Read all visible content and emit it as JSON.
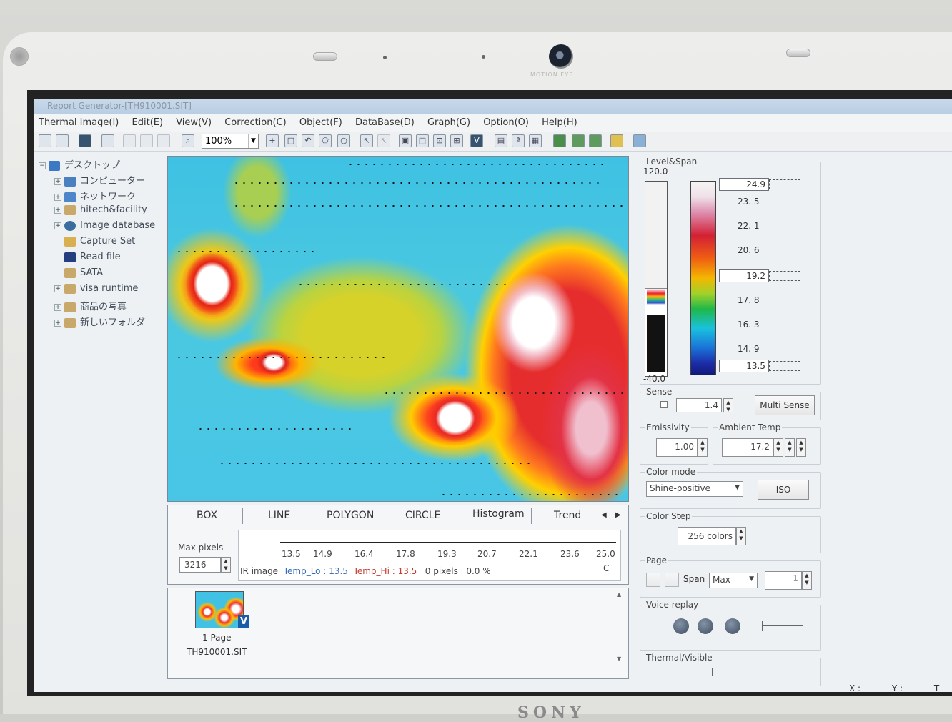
{
  "window": {
    "title": "Report Generator-[TH910001.SIT]"
  },
  "menu": [
    "Thermal Image(I)",
    "Edit(E)",
    "View(V)",
    "Correction(C)",
    "Object(F)",
    "DataBase(D)",
    "Graph(G)",
    "Option(O)",
    "Help(H)"
  ],
  "toolbar": {
    "zoom": "100%"
  },
  "tree": {
    "root": "デスクトップ",
    "items": [
      "コンピューター",
      "ネットワーク",
      "hitech&facility",
      "Image database",
      "Capture Set",
      "Read file",
      "SATA",
      "visa runtime",
      "商品の写真",
      "新しいフォルダ"
    ]
  },
  "analysis": {
    "tabs": [
      "BOX",
      "LINE",
      "POLYGON",
      "CIRCLE",
      "Histogram",
      "Trend"
    ],
    "max_pixels_label": "Max pixels",
    "max_pixels": "3216",
    "histogram_ticks": [
      "13.5",
      "14.9",
      "16.4",
      "17.8",
      "19.3",
      "20.7",
      "22.1",
      "23.6",
      "25.0"
    ],
    "unit": "C",
    "ir_label": "IR image",
    "temp_lo_label": "Temp_Lo :",
    "temp_lo": "13.5",
    "temp_hi_label": "Temp_Hi :",
    "temp_hi": "13.5",
    "pixels": "0 pixels",
    "percent": "0.0 %"
  },
  "pages": {
    "count_label": "1 Page",
    "file": "TH910001.SIT",
    "badge": "V"
  },
  "level_span": {
    "title": "Level&Span",
    "max": "120.0",
    "min": "-40.0",
    "scale_values": [
      "24.9",
      "23. 5",
      "22. 1",
      "20. 6",
      "19.2",
      "17. 8",
      "16. 3",
      "14. 9",
      "13.5"
    ]
  },
  "sense": {
    "title": "Sense",
    "value": "1.4",
    "multi_label": "Multi Sense"
  },
  "emissivity": {
    "title": "Emissivity",
    "value": "1.00"
  },
  "ambient": {
    "title": "Ambient Temp",
    "value": "17.2"
  },
  "color_mode": {
    "title": "Color mode",
    "value": "Shine-positive",
    "iso_label": "ISO"
  },
  "color_step": {
    "title": "Color Step",
    "value": "256 colors"
  },
  "page": {
    "title": "Page",
    "span_label": "Span",
    "span_value": "Max",
    "page_value": "1"
  },
  "voice": {
    "title": "Voice replay"
  },
  "thermal_visible": {
    "title": "Thermal/Visible"
  },
  "status": {
    "x": "X :",
    "y": "Y :",
    "t": "T"
  },
  "bezel": {
    "camera_label": "MOTION EYE",
    "brand": "SONY"
  }
}
